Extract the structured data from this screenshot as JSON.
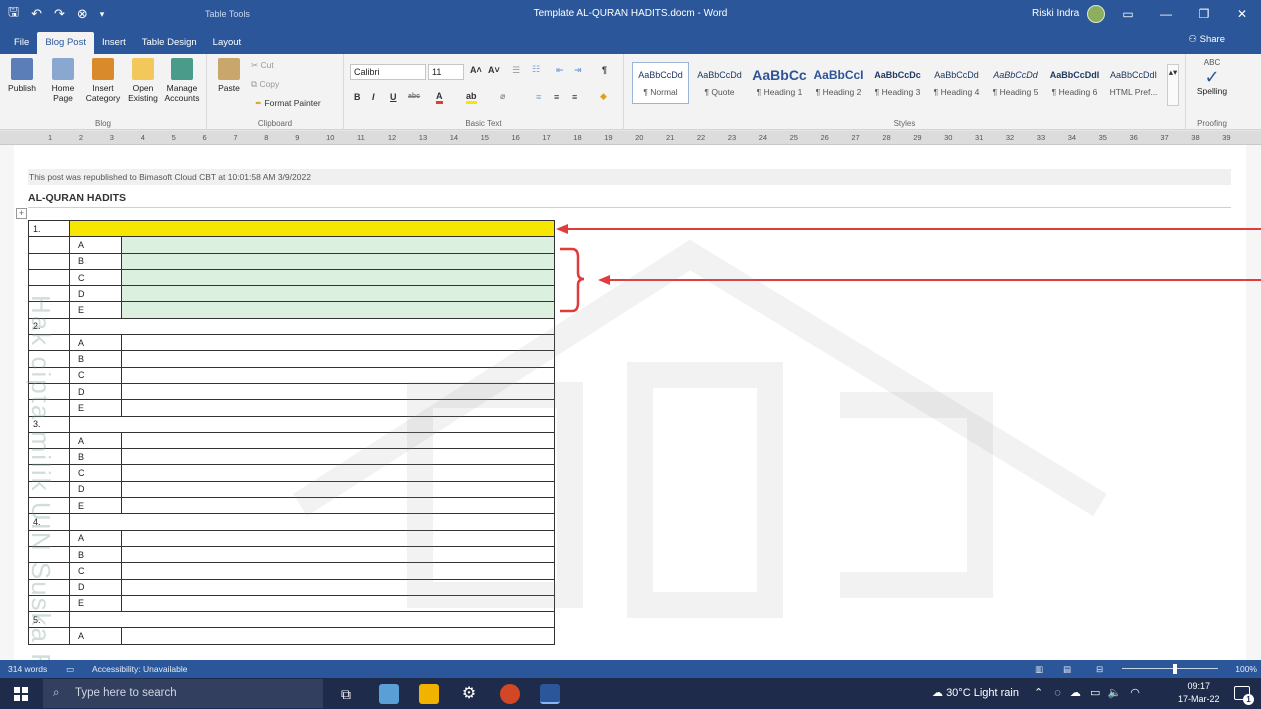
{
  "window": {
    "table_tools": "Table Tools",
    "title": "Template AL-QURAN HADITS.docm  -  Word",
    "user": "Riski Indra",
    "share": "Share"
  },
  "tabs": [
    "File",
    "Blog Post",
    "Insert",
    "Table Design",
    "Layout"
  ],
  "ribbon": {
    "blog": {
      "label": "Blog",
      "publish": "Publish",
      "home_page": "Home Page",
      "insert_category": "Insert Category",
      "open_existing": "Open Existing",
      "manage_accounts": "Manage Accounts"
    },
    "clipboard": {
      "label": "Clipboard",
      "paste": "Paste",
      "cut": "Cut",
      "copy": "Copy",
      "format_painter": "Format Painter"
    },
    "basic_text": {
      "label": "Basic Text",
      "font": "Calibri",
      "size": "11"
    },
    "styles": {
      "label": "Styles",
      "items": [
        {
          "preview": "AaBbCcDd",
          "name": "¶ Normal"
        },
        {
          "preview": "AaBbCcDd",
          "name": "¶ Quote"
        },
        {
          "preview": "AaBbCc",
          "name": "¶ Heading 1"
        },
        {
          "preview": "AaBbCcI",
          "name": "¶ Heading 2"
        },
        {
          "preview": "AaBbCcDc",
          "name": "¶ Heading 3"
        },
        {
          "preview": "AaBbCcDd",
          "name": "¶ Heading 4"
        },
        {
          "preview": "AaBbCcDd",
          "name": "¶ Heading 5"
        },
        {
          "preview": "AaBbCcDdI",
          "name": "¶ Heading 6"
        },
        {
          "preview": "AaBbCcDdI",
          "name": "HTML Pref..."
        }
      ]
    },
    "proofing": {
      "label": "Proofing",
      "spelling": "Spelling",
      "abc": "ABC"
    }
  },
  "document": {
    "publish_note": "This post was republished to Bimasoft Cloud CBT at 10:01:58 AM 3/9/2022",
    "heading": "AL-QURAN HADITS",
    "questions": [
      {
        "num": "1.",
        "options": [
          "A",
          "B",
          "C",
          "D",
          "E"
        ]
      },
      {
        "num": "2.",
        "options": [
          "A",
          "B",
          "C",
          "D",
          "E"
        ]
      },
      {
        "num": "3.",
        "options": [
          "A",
          "B",
          "C",
          "D",
          "E"
        ]
      },
      {
        "num": "4.",
        "options": [
          "A",
          "B",
          "C",
          "D",
          "E"
        ]
      },
      {
        "num": "5.",
        "options": [
          "A"
        ]
      }
    ]
  },
  "status": {
    "words": "314 words",
    "accessibility": "Accessibility: Unavailable",
    "zoom": "100%"
  },
  "taskbar": {
    "search_placeholder": "Type here to search",
    "weather": "30°C  Light rain",
    "time": "09:17",
    "date": "17-Mar-22",
    "notifications": "1"
  },
  "watermark_text": "Hak cipta milik UIN Suska Riau",
  "colors": {
    "word_blue": "#2b579a",
    "highlight_yellow": "#f6e600",
    "answer_green": "#dcf0df",
    "arrow_red": "#e03c3c"
  }
}
